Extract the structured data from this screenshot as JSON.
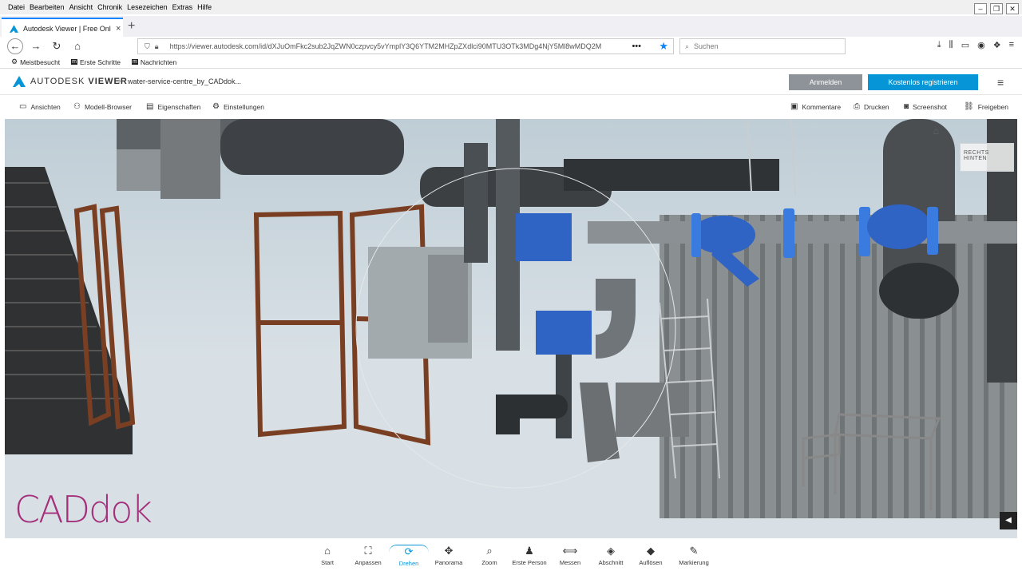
{
  "window": {
    "menu": [
      "Datei",
      "Bearbeiten",
      "Ansicht",
      "Chronik",
      "Lesezeichen",
      "Extras",
      "Hilfe"
    ],
    "controls": [
      "–",
      "❐",
      "✕"
    ]
  },
  "tab": {
    "title": "Autodesk Viewer | Free Online F",
    "close": "×",
    "new": "+"
  },
  "nav": {
    "url": "https://viewer.autodesk.com/id/dXJuOmFkc2sub2JqZWN0czpvcy5vYmplY3Q6YTM2MHZpZXdlci90MTU3OTk3MDg4NjY5Ml8wMDQ2M",
    "dots": "•••",
    "search_placeholder": "Suchen"
  },
  "bookmarks": [
    {
      "icon": "gear-icon",
      "label": "Meistbesucht"
    },
    {
      "icon": "m-icon",
      "label": "Erste Schritte"
    },
    {
      "icon": "m-icon",
      "label": "Nachrichten"
    }
  ],
  "header": {
    "brand_light": "AUTODESK",
    "brand_bold": "VIEWER",
    "breadcrumb": "water-service-centre_by_CADdok...",
    "login": "Anmelden",
    "register": "Kostenlos registrieren"
  },
  "toolbar": {
    "left": [
      "Ansichten",
      "Modell-Browser",
      "Eigenschaften",
      "Einstellungen"
    ],
    "right": [
      "Kommentare",
      "Drucken",
      "Screenshot",
      "Freigeben"
    ]
  },
  "viewport": {
    "logo_text": "CADdok",
    "viewcube_labels": "RECHTS  HINTEN"
  },
  "bottom_tools": [
    {
      "label": "Start",
      "icon": "⌂"
    },
    {
      "label": "Anpassen",
      "icon": "⛶"
    },
    {
      "label": "Drehen",
      "icon": "⟳"
    },
    {
      "label": "Panorama",
      "icon": "✥"
    },
    {
      "label": "Zoom",
      "icon": "⌕"
    },
    {
      "label": "Erste Person",
      "icon": "♟"
    },
    {
      "label": "Messen",
      "icon": "⟺"
    },
    {
      "label": "Abschnitt",
      "icon": "◈"
    },
    {
      "label": "Auflösen",
      "icon": "◆"
    },
    {
      "label": "Markierung",
      "icon": "✎"
    }
  ],
  "colors": {
    "accent": "#0696d7",
    "login_bg": "#8e939a",
    "logo": "#a4307b"
  }
}
